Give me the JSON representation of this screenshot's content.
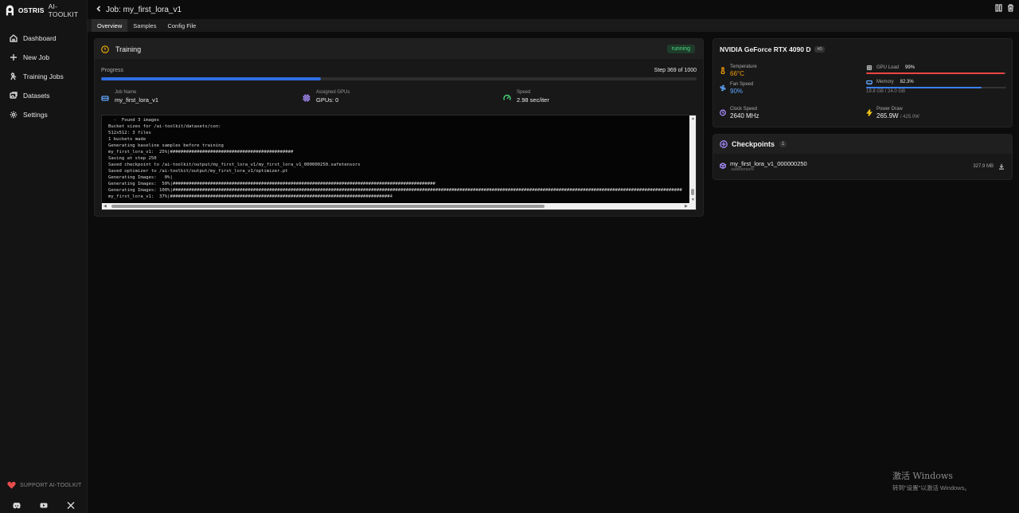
{
  "brand": {
    "name_bold": "OSTRIS",
    "name_rest": "AI-TOOLKIT"
  },
  "sidebar": {
    "items": [
      {
        "label": "Dashboard",
        "icon": "home-icon"
      },
      {
        "label": "New Job",
        "icon": "plus-icon"
      },
      {
        "label": "Training Jobs",
        "icon": "person-icon"
      },
      {
        "label": "Datasets",
        "icon": "images-icon"
      },
      {
        "label": "Settings",
        "icon": "gear-icon"
      }
    ],
    "support_label": "SUPPORT AI-TOOLKIT",
    "socials": [
      "discord-icon",
      "youtube-icon",
      "x-icon"
    ]
  },
  "header": {
    "title": "Job: my_first_lora_v1"
  },
  "tabs": [
    {
      "label": "Overview",
      "active": true
    },
    {
      "label": "Samples",
      "active": false
    },
    {
      "label": "Config File",
      "active": false
    }
  ],
  "training": {
    "title": "Training",
    "status": "running",
    "progress_label": "Progress",
    "step_text": "Step 369 of 1000",
    "progress_fraction": 0.369,
    "job_name_label": "Job Name",
    "job_name": "my_first_lora_v1",
    "gpus_label": "Assigned GPUs",
    "gpus": "GPUs: 0",
    "speed_label": "Speed",
    "speed": "2.98 sec/iter",
    "log_lines": [
      "  -  Found 3 images",
      "Bucket sizes for /ai-toolkit/datasets/con:",
      "512x512: 3 files",
      "1 buckets made",
      "Generating baseline samples before training",
      "my_first_lora_v1:  25%|##############################################",
      "Saving at step 250",
      "Saved checkpoint to /ai-toolkit/output/my_first_lora_v1/my_first_lora_v1_000000250.safetensors",
      "Saved optimizer to /ai-toolkit/output/my_first_lora_v1/optimizer.pt",
      "Generating Images:   0%|",
      "Generating Images:  50%|##################################################################################################",
      "Generating Images: 100%|##############################################################################################################################################################################################",
      "my_first_lora_v1:  37%|##################################################################################4"
    ]
  },
  "gpu": {
    "name": "NVIDIA GeForce RTX 4090 D",
    "index_badge": "#0",
    "temperature_label": "Temperature",
    "temperature": "66°C",
    "fan_label": "Fan Speed",
    "fan": "90%",
    "clock_label": "Clock Speed",
    "clock": "2640 MHz",
    "gpu_load_label": "GPU Load",
    "gpu_load": "99%",
    "gpu_load_fraction": 0.99,
    "memory_label": "Memory",
    "memory": "82.3%",
    "memory_fraction": 0.823,
    "memory_detail": "19.8 GB / 24.0 GB",
    "power_label": "Power Draw",
    "power_value": "265.9W",
    "power_max": "/ 425.0W",
    "colors": {
      "temperature": "#f59e0b",
      "fan": "#60a5fa",
      "gpu_load_bar": "#ef4444",
      "memory_bar": "#3b82f6",
      "power_icon": "#facc15",
      "clock_icon": "#a78bfa"
    }
  },
  "checkpoints": {
    "title": "Checkpoints",
    "count": "1",
    "items": [
      {
        "name": "my_first_lora_v1_000000250",
        "ext": ".safetensors",
        "size": "327.9 MB"
      }
    ]
  },
  "watermark": {
    "line1": "激活 Windows",
    "line2": "转到\"设置\"以激活 Windows。"
  }
}
